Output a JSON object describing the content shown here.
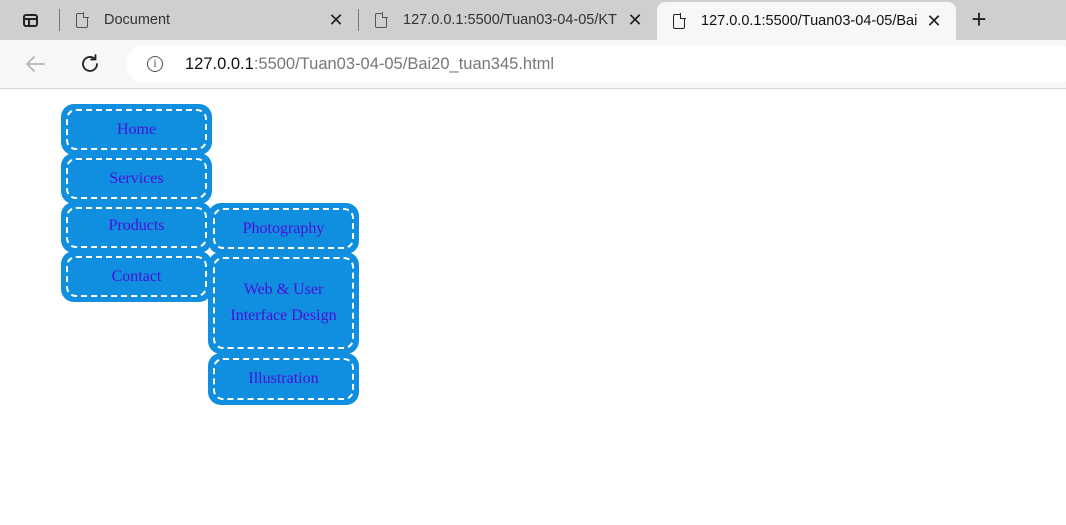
{
  "browser": {
    "tabs": [
      {
        "title": "Document",
        "active": false
      },
      {
        "title": "127.0.0.1:5500/Tuan03-04-05/KT",
        "active": false
      },
      {
        "title": "127.0.0.1:5500/Tuan03-04-05/Bai",
        "active": true
      }
    ],
    "close_glyph": "✕",
    "new_tab_glyph": "+",
    "address": {
      "host": "127.0.0.1",
      "rest": ":5500/Tuan03-04-05/Bai20_tuan345.html"
    }
  },
  "menu": {
    "items": [
      {
        "label": "Home"
      },
      {
        "label": "Services"
      },
      {
        "label": "Products"
      },
      {
        "label": "Contact"
      }
    ],
    "submenu": [
      {
        "label": "Photography"
      },
      {
        "label": "Web & User Interface Design"
      },
      {
        "label": "Illustration"
      }
    ]
  },
  "colors": {
    "menu_bg": "#108ee0",
    "menu_text": "#4b0fd8",
    "dashed_border": "#ffffff"
  }
}
